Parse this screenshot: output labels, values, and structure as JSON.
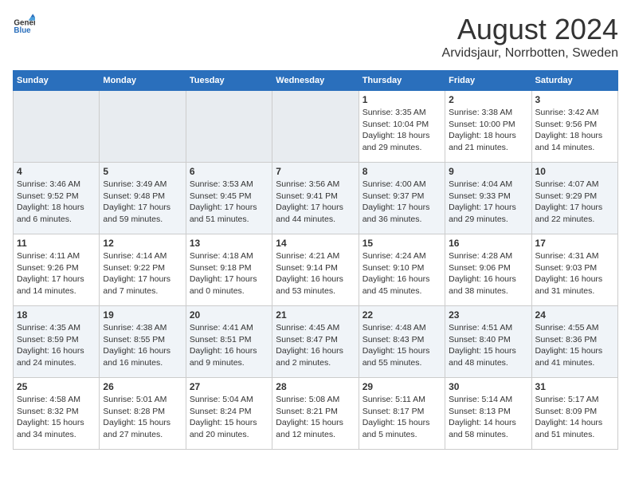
{
  "logo": {
    "text_general": "General",
    "text_blue": "Blue"
  },
  "title": "August 2024",
  "subtitle": "Arvidsjaur, Norrbotten, Sweden",
  "headers": [
    "Sunday",
    "Monday",
    "Tuesday",
    "Wednesday",
    "Thursday",
    "Friday",
    "Saturday"
  ],
  "weeks": [
    [
      {
        "day": "",
        "sunrise": "",
        "sunset": "",
        "daylight": ""
      },
      {
        "day": "",
        "sunrise": "",
        "sunset": "",
        "daylight": ""
      },
      {
        "day": "",
        "sunrise": "",
        "sunset": "",
        "daylight": ""
      },
      {
        "day": "",
        "sunrise": "",
        "sunset": "",
        "daylight": ""
      },
      {
        "day": "1",
        "sunrise": "Sunrise: 3:35 AM",
        "sunset": "Sunset: 10:04 PM",
        "daylight": "Daylight: 18 hours and 29 minutes."
      },
      {
        "day": "2",
        "sunrise": "Sunrise: 3:38 AM",
        "sunset": "Sunset: 10:00 PM",
        "daylight": "Daylight: 18 hours and 21 minutes."
      },
      {
        "day": "3",
        "sunrise": "Sunrise: 3:42 AM",
        "sunset": "Sunset: 9:56 PM",
        "daylight": "Daylight: 18 hours and 14 minutes."
      }
    ],
    [
      {
        "day": "4",
        "sunrise": "Sunrise: 3:46 AM",
        "sunset": "Sunset: 9:52 PM",
        "daylight": "Daylight: 18 hours and 6 minutes."
      },
      {
        "day": "5",
        "sunrise": "Sunrise: 3:49 AM",
        "sunset": "Sunset: 9:48 PM",
        "daylight": "Daylight: 17 hours and 59 minutes."
      },
      {
        "day": "6",
        "sunrise": "Sunrise: 3:53 AM",
        "sunset": "Sunset: 9:45 PM",
        "daylight": "Daylight: 17 hours and 51 minutes."
      },
      {
        "day": "7",
        "sunrise": "Sunrise: 3:56 AM",
        "sunset": "Sunset: 9:41 PM",
        "daylight": "Daylight: 17 hours and 44 minutes."
      },
      {
        "day": "8",
        "sunrise": "Sunrise: 4:00 AM",
        "sunset": "Sunset: 9:37 PM",
        "daylight": "Daylight: 17 hours and 36 minutes."
      },
      {
        "day": "9",
        "sunrise": "Sunrise: 4:04 AM",
        "sunset": "Sunset: 9:33 PM",
        "daylight": "Daylight: 17 hours and 29 minutes."
      },
      {
        "day": "10",
        "sunrise": "Sunrise: 4:07 AM",
        "sunset": "Sunset: 9:29 PM",
        "daylight": "Daylight: 17 hours and 22 minutes."
      }
    ],
    [
      {
        "day": "11",
        "sunrise": "Sunrise: 4:11 AM",
        "sunset": "Sunset: 9:26 PM",
        "daylight": "Daylight: 17 hours and 14 minutes."
      },
      {
        "day": "12",
        "sunrise": "Sunrise: 4:14 AM",
        "sunset": "Sunset: 9:22 PM",
        "daylight": "Daylight: 17 hours and 7 minutes."
      },
      {
        "day": "13",
        "sunrise": "Sunrise: 4:18 AM",
        "sunset": "Sunset: 9:18 PM",
        "daylight": "Daylight: 17 hours and 0 minutes."
      },
      {
        "day": "14",
        "sunrise": "Sunrise: 4:21 AM",
        "sunset": "Sunset: 9:14 PM",
        "daylight": "Daylight: 16 hours and 53 minutes."
      },
      {
        "day": "15",
        "sunrise": "Sunrise: 4:24 AM",
        "sunset": "Sunset: 9:10 PM",
        "daylight": "Daylight: 16 hours and 45 minutes."
      },
      {
        "day": "16",
        "sunrise": "Sunrise: 4:28 AM",
        "sunset": "Sunset: 9:06 PM",
        "daylight": "Daylight: 16 hours and 38 minutes."
      },
      {
        "day": "17",
        "sunrise": "Sunrise: 4:31 AM",
        "sunset": "Sunset: 9:03 PM",
        "daylight": "Daylight: 16 hours and 31 minutes."
      }
    ],
    [
      {
        "day": "18",
        "sunrise": "Sunrise: 4:35 AM",
        "sunset": "Sunset: 8:59 PM",
        "daylight": "Daylight: 16 hours and 24 minutes."
      },
      {
        "day": "19",
        "sunrise": "Sunrise: 4:38 AM",
        "sunset": "Sunset: 8:55 PM",
        "daylight": "Daylight: 16 hours and 16 minutes."
      },
      {
        "day": "20",
        "sunrise": "Sunrise: 4:41 AM",
        "sunset": "Sunset: 8:51 PM",
        "daylight": "Daylight: 16 hours and 9 minutes."
      },
      {
        "day": "21",
        "sunrise": "Sunrise: 4:45 AM",
        "sunset": "Sunset: 8:47 PM",
        "daylight": "Daylight: 16 hours and 2 minutes."
      },
      {
        "day": "22",
        "sunrise": "Sunrise: 4:48 AM",
        "sunset": "Sunset: 8:43 PM",
        "daylight": "Daylight: 15 hours and 55 minutes."
      },
      {
        "day": "23",
        "sunrise": "Sunrise: 4:51 AM",
        "sunset": "Sunset: 8:40 PM",
        "daylight": "Daylight: 15 hours and 48 minutes."
      },
      {
        "day": "24",
        "sunrise": "Sunrise: 4:55 AM",
        "sunset": "Sunset: 8:36 PM",
        "daylight": "Daylight: 15 hours and 41 minutes."
      }
    ],
    [
      {
        "day": "25",
        "sunrise": "Sunrise: 4:58 AM",
        "sunset": "Sunset: 8:32 PM",
        "daylight": "Daylight: 15 hours and 34 minutes."
      },
      {
        "day": "26",
        "sunrise": "Sunrise: 5:01 AM",
        "sunset": "Sunset: 8:28 PM",
        "daylight": "Daylight: 15 hours and 27 minutes."
      },
      {
        "day": "27",
        "sunrise": "Sunrise: 5:04 AM",
        "sunset": "Sunset: 8:24 PM",
        "daylight": "Daylight: 15 hours and 20 minutes."
      },
      {
        "day": "28",
        "sunrise": "Sunrise: 5:08 AM",
        "sunset": "Sunset: 8:21 PM",
        "daylight": "Daylight: 15 hours and 12 minutes."
      },
      {
        "day": "29",
        "sunrise": "Sunrise: 5:11 AM",
        "sunset": "Sunset: 8:17 PM",
        "daylight": "Daylight: 15 hours and 5 minutes."
      },
      {
        "day": "30",
        "sunrise": "Sunrise: 5:14 AM",
        "sunset": "Sunset: 8:13 PM",
        "daylight": "Daylight: 14 hours and 58 minutes."
      },
      {
        "day": "31",
        "sunrise": "Sunrise: 5:17 AM",
        "sunset": "Sunset: 8:09 PM",
        "daylight": "Daylight: 14 hours and 51 minutes."
      }
    ]
  ]
}
